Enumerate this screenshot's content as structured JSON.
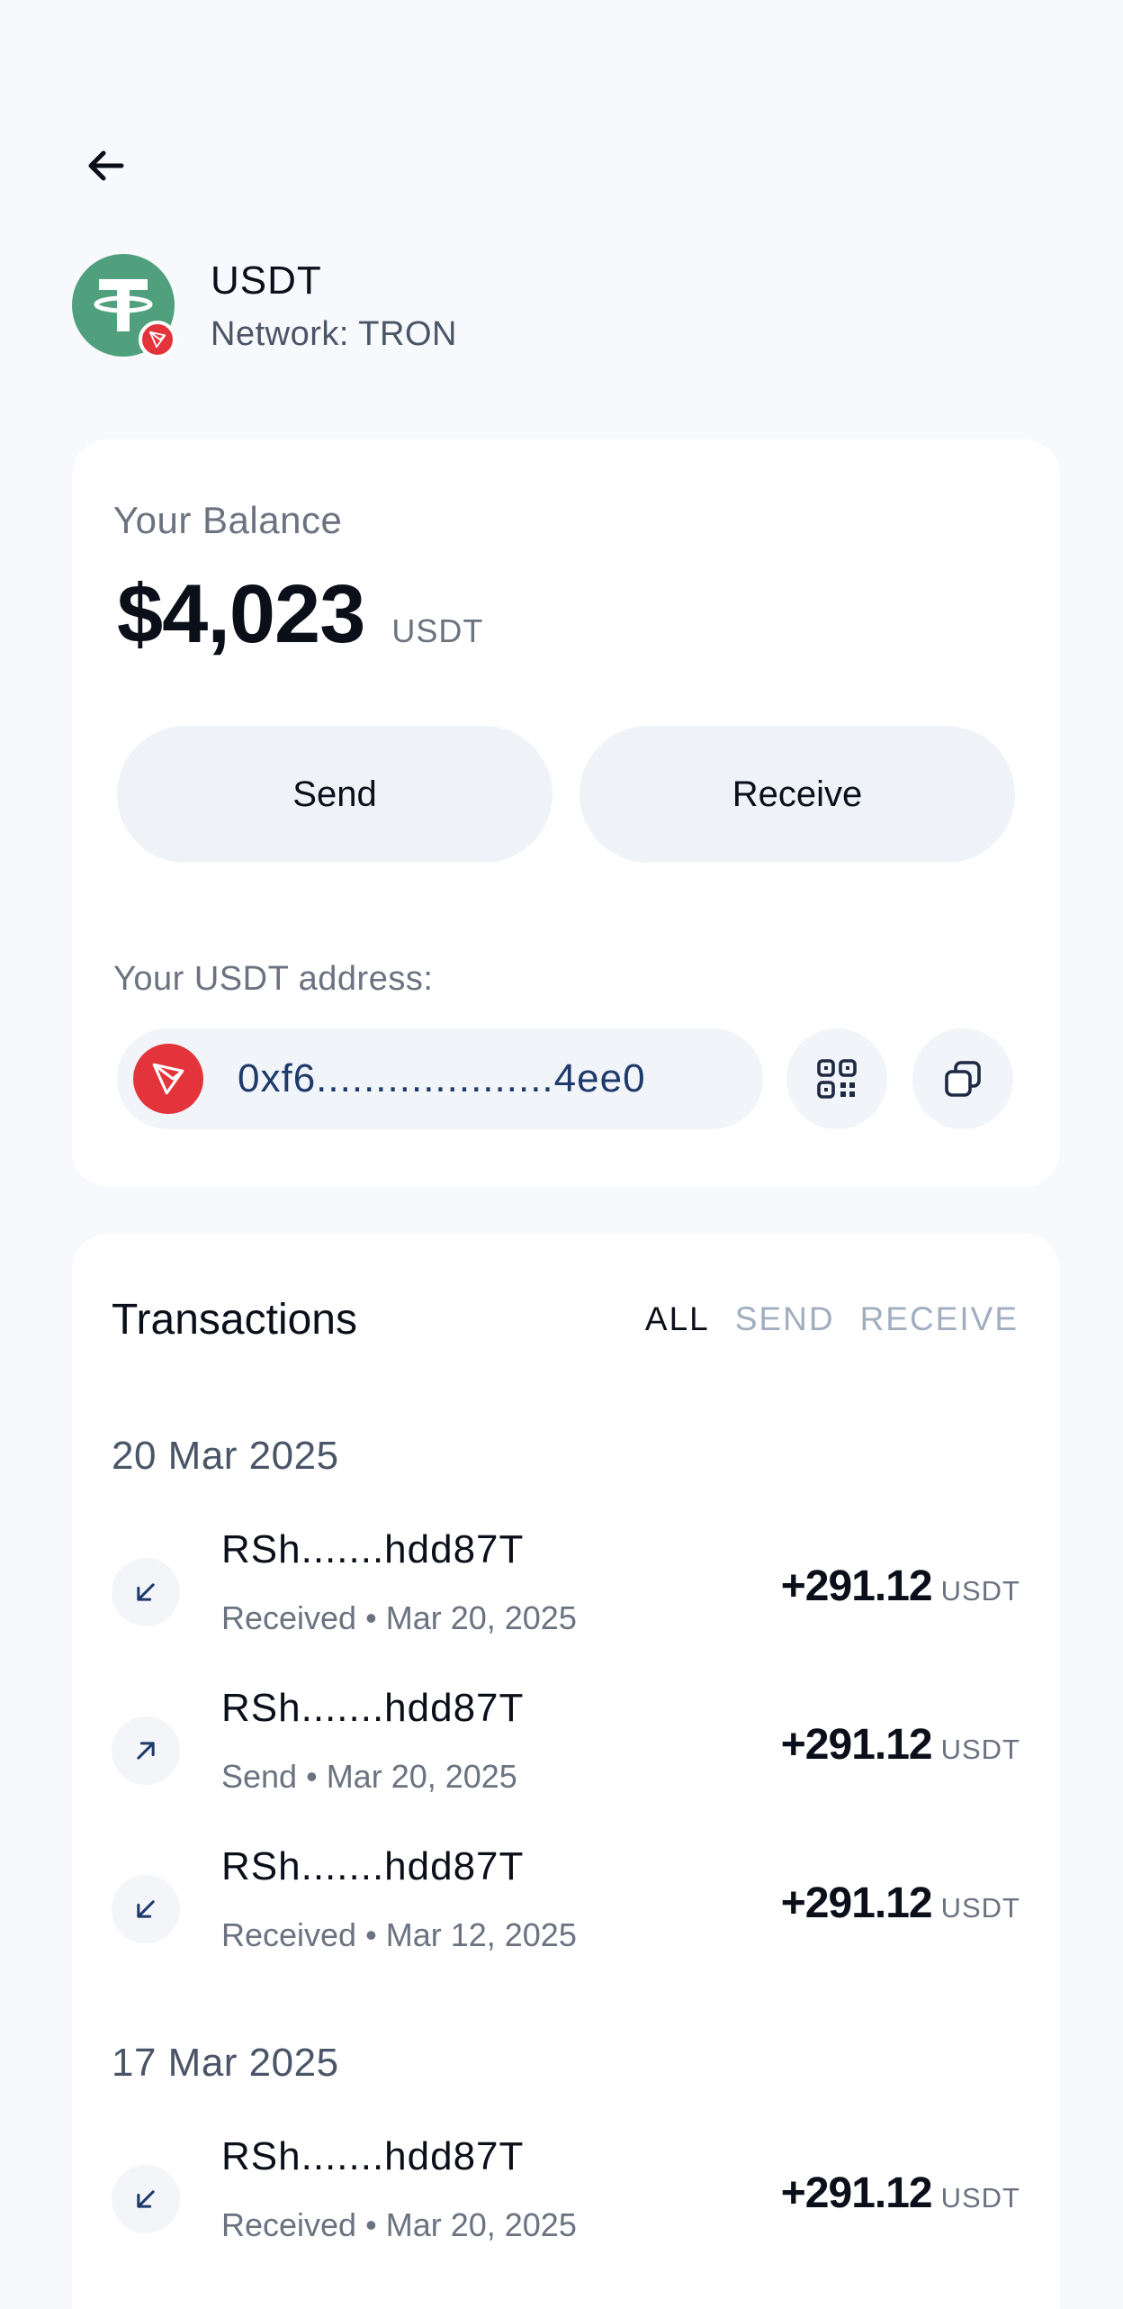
{
  "header": {
    "back_icon": "arrow-left-icon"
  },
  "token": {
    "name": "USDT",
    "network": "Network: TRON",
    "logo_color": "#50a07e",
    "badge_color": "#e3343b"
  },
  "balance": {
    "label": "Your Balance",
    "amount": "$4,023",
    "unit": "USDT",
    "send_label": "Send",
    "receive_label": "Receive"
  },
  "address": {
    "label": "Your USDT address:",
    "value": "0xf6....................4ee0",
    "qr_icon": "qr-code-icon",
    "copy_icon": "copy-icon"
  },
  "transactions": {
    "title": "Transactions",
    "filters": [
      "ALL",
      "SEND",
      "RECEIVE"
    ],
    "active_filter": "ALL",
    "groups": [
      {
        "date": "20 Mar 2025",
        "items": [
          {
            "address": "RSh.......hdd87T",
            "type": "Received",
            "date": "Mar 20, 2025",
            "amount": "+291.12",
            "unit": "USDT",
            "icon": "arrow-down-left-icon"
          },
          {
            "address": "RSh.......hdd87T",
            "type": "Send",
            "date": "Mar 20, 2025",
            "amount": "+291.12",
            "unit": "USDT",
            "icon": "arrow-up-right-icon"
          },
          {
            "address": "RSh.......hdd87T",
            "type": "Received",
            "date": "Mar 12, 2025",
            "amount": "+291.12",
            "unit": "USDT",
            "icon": "arrow-down-left-icon"
          }
        ]
      },
      {
        "date": "17 Mar 2025",
        "items": [
          {
            "address": "RSh.......hdd87T",
            "type": "Received",
            "date": "Mar 20, 2025",
            "amount": "+291.12",
            "unit": "USDT",
            "icon": "arrow-down-left-icon"
          }
        ]
      }
    ],
    "meta_separator": " • "
  }
}
